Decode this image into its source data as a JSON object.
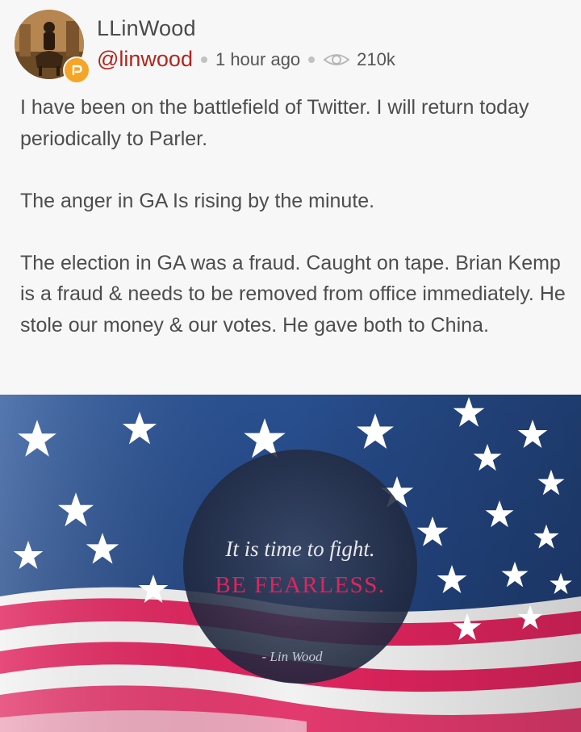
{
  "post": {
    "display_name": "LLinWood",
    "handle": "@linwood",
    "timestamp": "1 hour ago",
    "views": "210k",
    "paragraphs": [
      "I have been on the battlefield of Twitter. I will return today periodically to Parler.",
      "The anger in GA Is rising by the minute.",
      "The election in GA was a fraud. Caught on tape. Brian Kemp is a fraud & needs to be removed from office immediately. He stole our money & our votes. He gave both to China."
    ]
  },
  "image": {
    "quote_line1": "It is time to fight.",
    "quote_line2": "BE FEARLESS.",
    "attribution": "- Lin Wood"
  },
  "colors": {
    "handle": "#b3261e",
    "badge": "#f4a526",
    "flag_blue": "#2c4f8c",
    "flag_red": "#e0245e",
    "circle_overlay": "#1f2a44"
  },
  "icons": {
    "badge": "parler-badge-icon",
    "views": "eye-icon"
  }
}
